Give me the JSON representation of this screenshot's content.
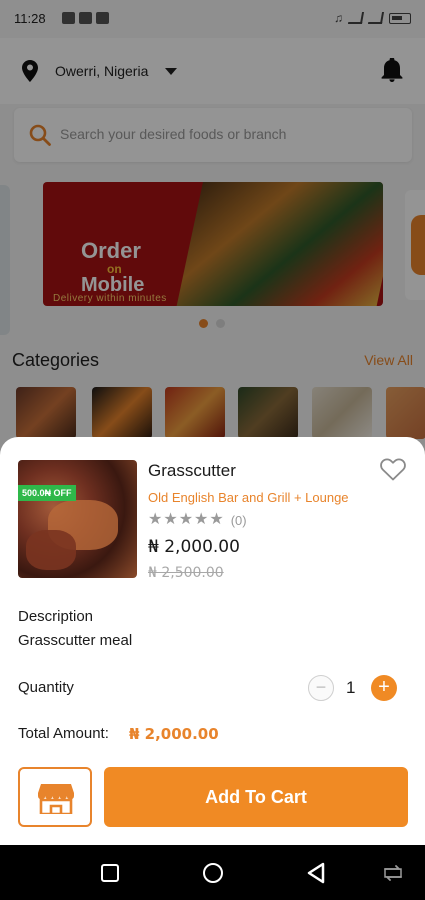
{
  "status_bar": {
    "time": "11:28"
  },
  "header": {
    "location": "Owerri, Nigeria"
  },
  "search": {
    "placeholder": "Search your desired foods or branch"
  },
  "banner": {
    "title_line1": "Order",
    "title_on": "on",
    "title_line2": "Mobile",
    "subtitle": "Delivery within minutes"
  },
  "categories": {
    "title": "Categories",
    "view_all": "View All"
  },
  "product": {
    "name": "Grasscutter",
    "discount_badge": "500.0₦ OFF",
    "vendor": "Old English Bar and Grill + Lounge",
    "rating_stars": 0,
    "rating_count": "(0)",
    "price": "₦ 2,000.00",
    "old_price": "₦ 2,500.00",
    "description_label": "Description",
    "description": "Grasscutter meal",
    "quantity_label": "Quantity",
    "quantity": "1",
    "total_label": "Total Amount:",
    "total_value": "₦ 2,000.00"
  },
  "actions": {
    "add_to_cart": "Add To Cart"
  },
  "colors": {
    "accent": "#f08a24",
    "accent_text": "#e8842c",
    "badge_green": "#2fb84a",
    "banner_red": "#a81214"
  },
  "icons": {
    "location": "location-pin-icon",
    "bell": "bell-icon",
    "search": "search-icon",
    "favorite": "heart-outline-icon",
    "store": "storefront-icon",
    "nav": [
      "recent-apps-icon",
      "home-icon",
      "back-icon",
      "rotate-icon"
    ]
  }
}
